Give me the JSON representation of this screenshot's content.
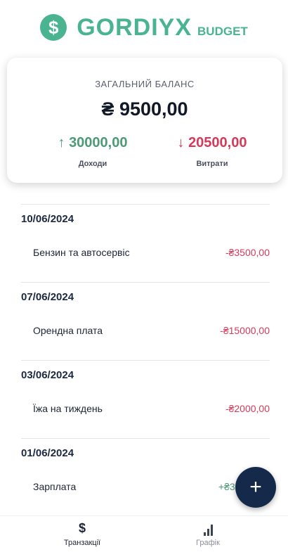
{
  "header": {
    "logo_icon": "dollar-coin-icon",
    "logo_symbol": "$",
    "title": "GORDIYX",
    "subtitle": "BUDGET",
    "brand_color": "#4ab491"
  },
  "balance": {
    "label": "ЗАГАЛЬНИЙ БАЛАНС",
    "amount": "₴ 9500,00",
    "income": {
      "arrow": "↑",
      "value": "30000,00",
      "label": "Доходи",
      "color": "#4c9b76"
    },
    "expense": {
      "arrow": "↓",
      "value": "20500,00",
      "label": "Витрати",
      "color": "#d63a5b"
    }
  },
  "transactions": [
    {
      "date": "10/06/2024",
      "name": "Бензин та автосервіс",
      "amount": "-₴3500,00",
      "type": "expense"
    },
    {
      "date": "07/06/2024",
      "name": "Орендна плата",
      "amount": "-₴15000,00",
      "type": "expense"
    },
    {
      "date": "03/06/2024",
      "name": "Їжа на тиждень",
      "amount": "-₴2000,00",
      "type": "expense"
    },
    {
      "date": "01/06/2024",
      "name": "Зарплата",
      "amount": "+₴3000",
      "type": "income"
    }
  ],
  "fab": {
    "icon": "plus-icon",
    "symbol": "+"
  },
  "nav": {
    "transactions": {
      "icon": "dollar-icon",
      "symbol": "$",
      "label": "Транзакції",
      "active": true
    },
    "chart": {
      "icon": "bar-chart-icon",
      "label": "Графік",
      "active": false
    }
  }
}
